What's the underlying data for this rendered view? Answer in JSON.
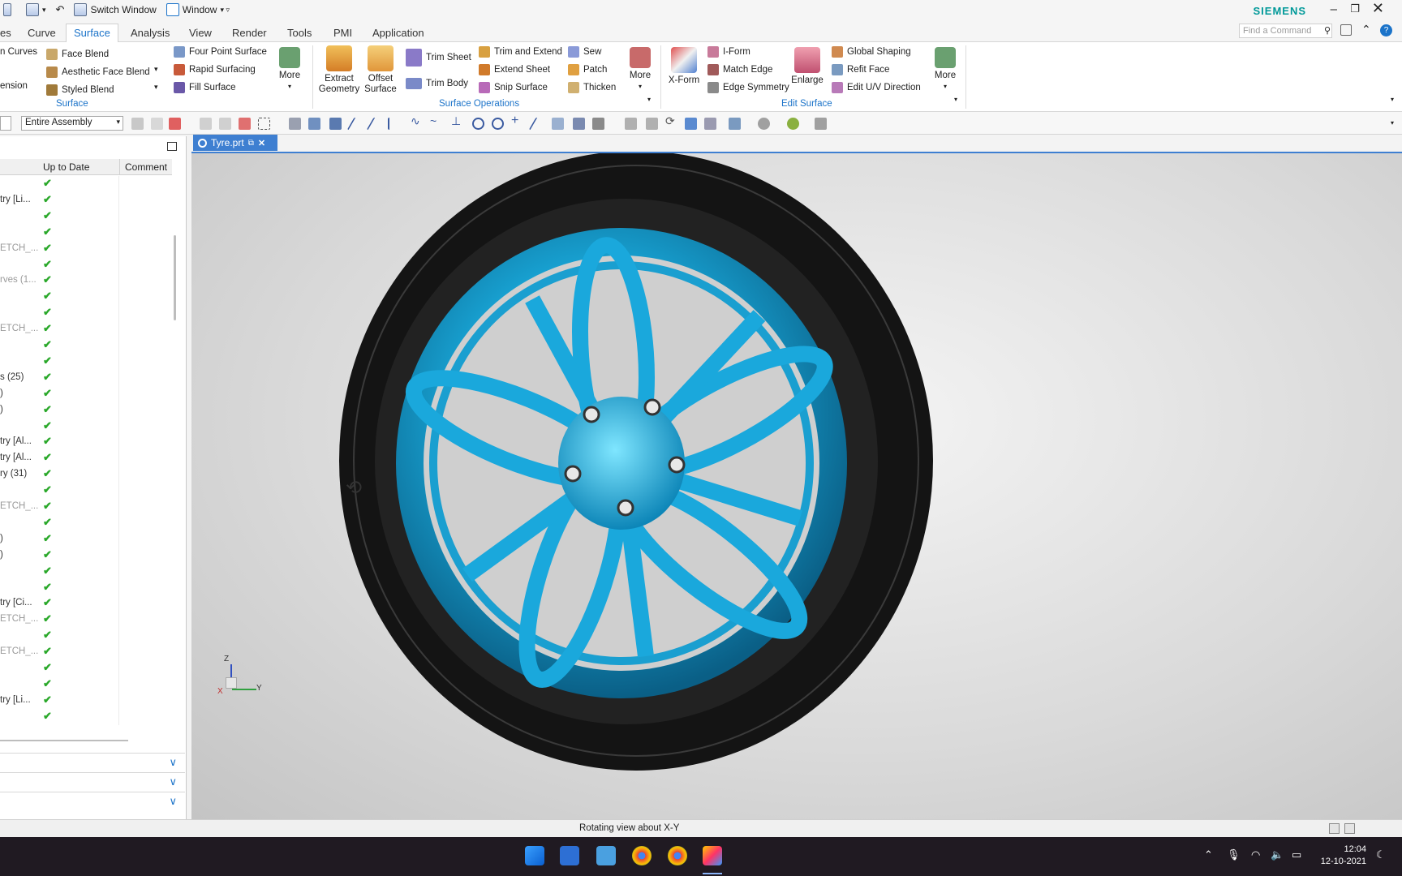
{
  "titlebar": {
    "switch_window": "Switch Window",
    "window": "Window",
    "brand": "SIEMENS"
  },
  "tabs": [
    {
      "label": "es"
    },
    {
      "label": "Curve"
    },
    {
      "label": "Surface"
    },
    {
      "label": "Analysis"
    },
    {
      "label": "View"
    },
    {
      "label": "Render"
    },
    {
      "label": "Tools"
    },
    {
      "label": "PMI"
    },
    {
      "label": "Application"
    }
  ],
  "active_tab": "Surface",
  "find_command_placeholder": "Find a Command",
  "ribbon": {
    "left_clip": {
      "top": "n Curves",
      "bottom": "ension"
    },
    "surface_group": {
      "items": [
        "Face Blend",
        "Aesthetic Face Blend",
        "Styled Blend",
        "Four Point Surface",
        "Rapid Surfacing",
        "Fill Surface"
      ],
      "more": "More",
      "label": "Surface"
    },
    "surface_operations": {
      "extract": "Extract Geometry",
      "offset": "Offset Surface",
      "items": [
        "Trim Sheet",
        "Trim Body",
        "Trim and Extend",
        "Extend Sheet",
        "Snip Surface",
        "Sew",
        "Patch",
        "Thicken"
      ],
      "more": "More",
      "label": "Surface Operations"
    },
    "edit_surface": {
      "xform": "X-Form",
      "items": [
        "I-Form",
        "Match Edge",
        "Edge Symmetry"
      ],
      "enlarge": "Enlarge",
      "items2": [
        "Global Shaping",
        "Refit Face",
        "Edit U/V Direction"
      ],
      "more": "More",
      "label": "Edit Surface"
    }
  },
  "toolbar": {
    "assembly_filter": "Entire Assembly"
  },
  "nav": {
    "col_uptodate": "Up to Date",
    "col_comment": "Comment",
    "rows": [
      {
        "name": "",
        "gray": false
      },
      {
        "name": "try [Li...",
        "gray": false
      },
      {
        "name": "",
        "gray": false
      },
      {
        "name": "",
        "gray": false
      },
      {
        "name": "ETCH_...",
        "gray": true
      },
      {
        "name": "",
        "gray": false
      },
      {
        "name": "rves (1...",
        "gray": true
      },
      {
        "name": "",
        "gray": false
      },
      {
        "name": "",
        "gray": false
      },
      {
        "name": "ETCH_...",
        "gray": true
      },
      {
        "name": "",
        "gray": false
      },
      {
        "name": "",
        "gray": false
      },
      {
        "name": "s (25)",
        "gray": false
      },
      {
        "name": ")",
        "gray": false
      },
      {
        "name": ")",
        "gray": false
      },
      {
        "name": "",
        "gray": false
      },
      {
        "name": "try [Al...",
        "gray": false
      },
      {
        "name": "try [Al...",
        "gray": false
      },
      {
        "name": "ry (31)",
        "gray": false
      },
      {
        "name": "",
        "gray": false
      },
      {
        "name": "ETCH_...",
        "gray": true
      },
      {
        "name": "",
        "gray": false
      },
      {
        "name": ")",
        "gray": false
      },
      {
        "name": ")",
        "gray": false
      },
      {
        "name": "",
        "gray": false
      },
      {
        "name": "",
        "gray": false
      },
      {
        "name": "try [Ci...",
        "gray": false
      },
      {
        "name": "ETCH_...",
        "gray": true
      },
      {
        "name": "",
        "gray": false
      },
      {
        "name": "ETCH_...",
        "gray": true
      },
      {
        "name": "",
        "gray": false
      },
      {
        "name": "",
        "gray": false
      },
      {
        "name": "try [Li...",
        "gray": false
      },
      {
        "name": "",
        "gray": false
      }
    ]
  },
  "document_tab": "Tyre.prt",
  "triad": {
    "z": "Z",
    "y": "Y",
    "x": "X"
  },
  "status": "Rotating view about X-Y",
  "clock": {
    "time": "12:04",
    "date": "12-10-2021"
  }
}
